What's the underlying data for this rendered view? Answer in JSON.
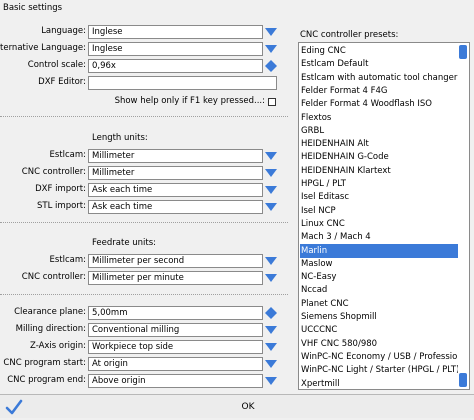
{
  "window": {
    "title": "Basic settings"
  },
  "basic": {
    "language": {
      "label": "Language:",
      "value": "Inglese"
    },
    "alt_language": {
      "label": "Alternative Language:",
      "value": "Inglese"
    },
    "control_scale": {
      "label": "Control scale:",
      "value": "0,96x"
    },
    "dxf_editor": {
      "label": "DXF Editor:",
      "value": ""
    },
    "show_help": {
      "label": "Show help only if F1 key pressed...:"
    }
  },
  "length_units": {
    "header": "Length units:",
    "estlcam": {
      "label": "Estlcam:",
      "value": "Millimeter"
    },
    "cnc_controller": {
      "label": "CNC controller:",
      "value": "Millimeter"
    },
    "dxf_import": {
      "label": "DXF import:",
      "value": "Ask each time"
    },
    "stl_import": {
      "label": "STL import:",
      "value": "Ask each time"
    }
  },
  "feedrate_units": {
    "header": "Feedrate units:",
    "estlcam": {
      "label": "Estlcam:",
      "value": "Millimeter per second"
    },
    "cnc_controller": {
      "label": "CNC controller:",
      "value": "Millimeter per minute"
    }
  },
  "machining": {
    "clearance_plane": {
      "label": "Clearance plane:",
      "value": "5,00mm"
    },
    "milling_direction": {
      "label": "Milling direction:",
      "value": "Conventional milling"
    },
    "z_axis_origin": {
      "label": "Z-Axis origin:",
      "value": "Workpiece top side"
    },
    "program_start": {
      "label": "CNC program start:",
      "value": "At origin"
    },
    "program_end": {
      "label": "CNC program end:",
      "value": "Above origin"
    }
  },
  "presets": {
    "label": "CNC controller presets:",
    "selected": "Marlin",
    "items": [
      "Eding CNC",
      "Estlcam Default",
      "Estlcam with automatic tool changer",
      "Felder Format 4 F4G",
      "Felder Format 4 Woodflash ISO",
      "Flextos",
      "GRBL",
      "HEIDENHAIN Alt",
      "HEIDENHAIN G-Code",
      "HEIDENHAIN Klartext",
      "HPGL / PLT",
      "Isel Editasc",
      "Isel NCP",
      "Linux CNC",
      "Mach 3 / Mach 4",
      "Marlin",
      "Maslow",
      "NC-Easy",
      "Nccad",
      "Planet CNC",
      "Siemens Shopmill",
      "UCCCNC",
      "VHF CNC 580/980",
      "WinPC-NC Economy / USB / Professional",
      "WinPC-NC Light / Starter (HPGL / PLT)",
      "Xpertmill"
    ]
  },
  "ok_button": {
    "label": "OK"
  },
  "colors": {
    "accent": "#3b7ad8",
    "dropdown_arrow": "#3b7ad8"
  }
}
